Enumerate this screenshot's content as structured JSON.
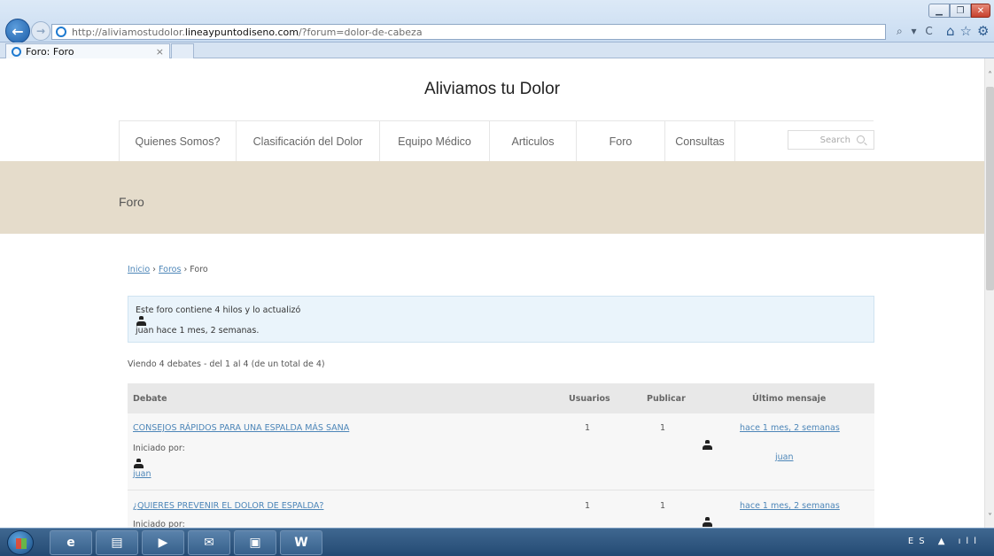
{
  "browser": {
    "url_prefix": "http://aliviamostudolor.",
    "url_host": "lineaypuntodiseno.com",
    "url_suffix": "/?forum=dolor-de-cabeza",
    "address_tools": "⌕ ▾ C",
    "tab_title": "Foro: Foro",
    "tab_close": "×",
    "window_min": "▁",
    "window_max": "❐",
    "window_close": "✕"
  },
  "site": {
    "title": "Aliviamos tu Dolor",
    "nav": [
      "Quienes Somos?",
      "Clasificación del Dolor",
      "Equipo Médico",
      "Articulos",
      "Foro",
      "Consultas"
    ],
    "search_placeholder": "Search",
    "banner_title": "Foro"
  },
  "breadcrumb": {
    "home": "Inicio",
    "sep1": "›",
    "forums": "Foros",
    "sep2": "›",
    "current": "Foro"
  },
  "info": {
    "line1": "Este foro contiene 4 hilos y lo actualizó",
    "line2": "juan hace 1 mes, 2 semanas."
  },
  "viewing": "Viendo 4 debates - del 1 al 4 (de un total de 4)",
  "table": {
    "headers": {
      "debate": "Debate",
      "users": "Usuarios",
      "posts": "Publicar",
      "last": "Último mensaje"
    },
    "rows": [
      {
        "title": "CONSEJOS RÁPIDOS PARA UNA ESPALDA MÁS SANA",
        "started_by": "Iniciado por:",
        "author": "juan",
        "users": "1",
        "posts": "1",
        "last_time": "hace 1 mes, 2 semanas",
        "last_author": "juan"
      },
      {
        "title": "¿QUIERES PREVENIR EL DOLOR DE ESPALDA?",
        "started_by": "Iniciado por:",
        "author": "",
        "users": "1",
        "posts": "1",
        "last_time": "hace 1 mes, 2 semanas",
        "last_author": ""
      }
    ]
  },
  "taskbar": {
    "language": "ES",
    "tray_icons": "▲ ıll"
  },
  "colors": {
    "banner": "#e5dccb",
    "info_box": "#eaf4fb",
    "link": "#4d86b8",
    "taskbar": "#2f5a85"
  }
}
